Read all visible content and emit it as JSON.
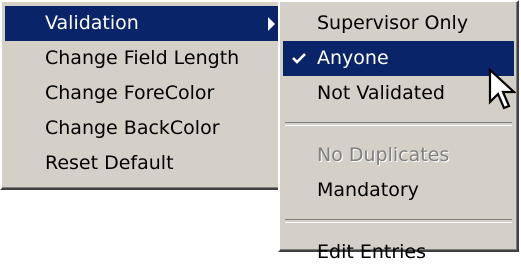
{
  "main_menu": {
    "items": [
      {
        "label": "Validation",
        "selected": true,
        "submenu": true
      },
      {
        "label": "Change Field Length"
      },
      {
        "label": "Change ForeColor"
      },
      {
        "label": "Change BackColor"
      },
      {
        "label": "Reset Default"
      }
    ]
  },
  "sub_menu": {
    "items": [
      {
        "label": "Supervisor Only"
      },
      {
        "label": "Anyone",
        "checked": true,
        "selected": true
      },
      {
        "label": "Not Validated"
      },
      {
        "label": "No Duplicates",
        "disabled": true
      },
      {
        "label": "Mandatory"
      },
      {
        "label": "Edit Entries"
      }
    ]
  },
  "colors": {
    "menu_background": "#d4d0c8",
    "highlight": "#0a246a",
    "highlight_text": "#ffffff",
    "disabled_text": "#808080"
  },
  "icons": {
    "submenu_arrow": "right-triangle-arrow-icon",
    "check": "checkmark-icon",
    "cursor": "mouse-pointer-icon"
  }
}
